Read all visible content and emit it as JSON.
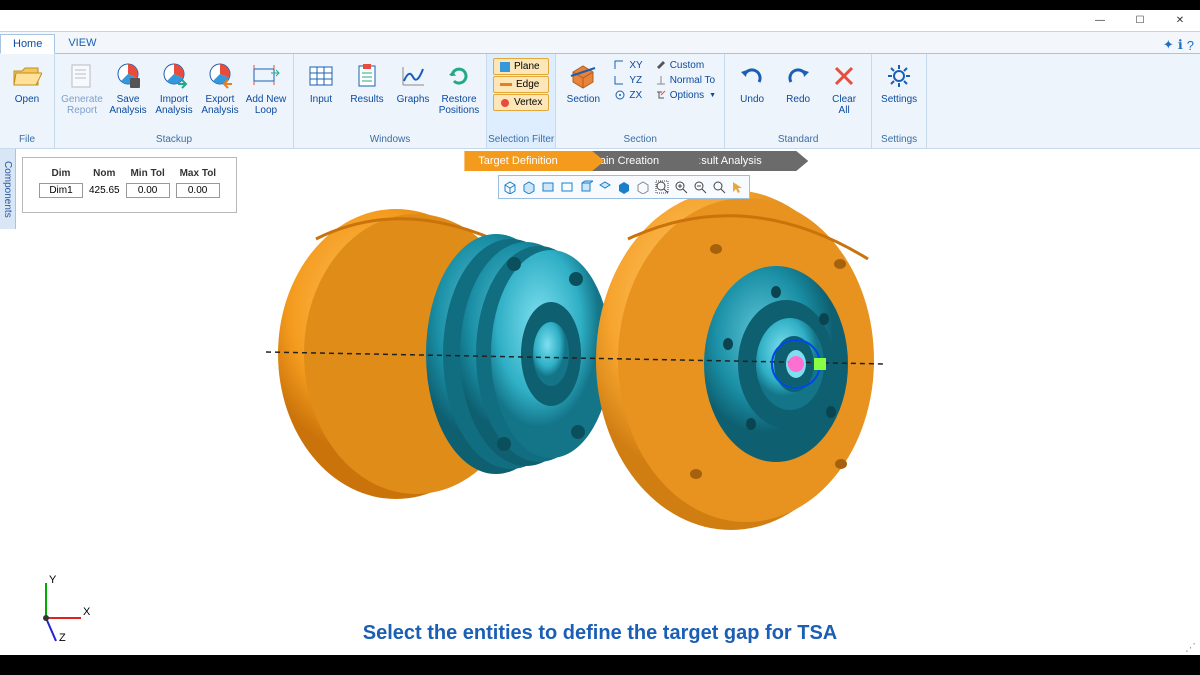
{
  "titlebar": {
    "minimize": "—",
    "maximize": "☐",
    "close": "✕"
  },
  "tabs": {
    "home": "Home",
    "view": "VIEW"
  },
  "tabbar_icons": [
    "✦",
    "ℹ",
    "?"
  ],
  "ribbon": {
    "file": {
      "title": "File",
      "open": "Open"
    },
    "stackup": {
      "title": "Stackup",
      "generate_report": "Generate\nReport",
      "save_analysis": "Save\nAnalysis",
      "import_analysis": "Import\nAnalysis",
      "export_analysis": "Export\nAnalysis",
      "add_new_loop": "Add New\nLoop"
    },
    "windows": {
      "title": "Windows",
      "input": "Input",
      "results": "Results",
      "graphs": "Graphs",
      "restore_positions": "Restore\nPositions"
    },
    "selection_filter": {
      "title": "Selection Filter",
      "plane": "Plane",
      "edge": "Edge",
      "vertex": "Vertex"
    },
    "section": {
      "title": "Section",
      "section": "Section",
      "xy": "XY",
      "yz": "YZ",
      "zx": "ZX",
      "custom": "Custom",
      "normal_to": "Normal To",
      "options": "Options"
    },
    "standard": {
      "title": "Standard",
      "undo": "Undo",
      "redo": "Redo",
      "clear_all": "Clear\nAll"
    },
    "settings": {
      "title": "Settings",
      "settings": "Settings"
    }
  },
  "side_tab": "Components",
  "dim_table": {
    "headers": [
      "Dim",
      "Nom",
      "Min Tol",
      "Max Tol"
    ],
    "row": {
      "dim": "Dim1",
      "nom": "425.65",
      "min_tol": "0.00",
      "max_tol": "0.00"
    }
  },
  "pill_tabs": {
    "target_definition": "Target Definition",
    "chain_creation": "Chain Creation",
    "result_analysis": "Result Analysis"
  },
  "triad": {
    "x": "X",
    "y": "Y",
    "z": "Z"
  },
  "instruction": "Select the entities to define the target gap for TSA"
}
